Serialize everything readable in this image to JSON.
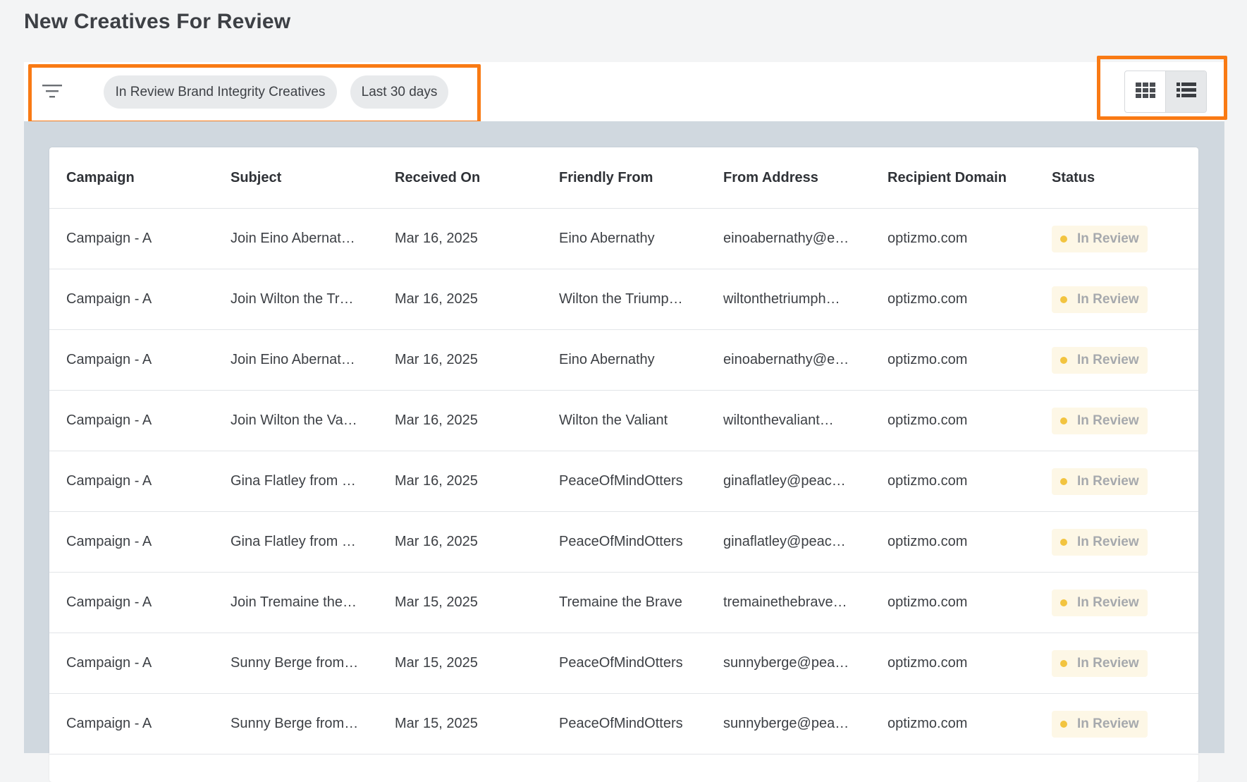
{
  "page": {
    "title": "New Creatives For Review"
  },
  "filters": {
    "chips": [
      "In Review Brand Integrity Creatives",
      "Last 30 days"
    ]
  },
  "view_toggle": {
    "active": "list"
  },
  "colors": {
    "accent_highlight": "#f97a14",
    "status_dot": "#f2c440",
    "status_bg": "#fdf7e6"
  },
  "table": {
    "headers": [
      "Campaign",
      "Subject",
      "Received On",
      "Friendly From",
      "From Address",
      "Recipient Domain",
      "Status"
    ],
    "rows": [
      {
        "campaign": "Campaign - A",
        "subject": "Join Eino Abernat…",
        "received": "Mar 16, 2025",
        "friendly_from": "Eino Abernathy",
        "from_address": "einoabernathy@e…",
        "domain": "optizmo.com",
        "status": "In Review"
      },
      {
        "campaign": "Campaign - A",
        "subject": "Join Wilton the Tr…",
        "received": "Mar 16, 2025",
        "friendly_from": "Wilton the Triump…",
        "from_address": "wiltonthetriumph…",
        "domain": "optizmo.com",
        "status": "In Review"
      },
      {
        "campaign": "Campaign - A",
        "subject": "Join Eino Abernat…",
        "received": "Mar 16, 2025",
        "friendly_from": "Eino Abernathy",
        "from_address": "einoabernathy@e…",
        "domain": "optizmo.com",
        "status": "In Review"
      },
      {
        "campaign": "Campaign - A",
        "subject": "Join Wilton the Va…",
        "received": "Mar 16, 2025",
        "friendly_from": "Wilton the Valiant",
        "from_address": "wiltonthevaliant…",
        "domain": "optizmo.com",
        "status": "In Review"
      },
      {
        "campaign": "Campaign - A",
        "subject": "Gina Flatley from …",
        "received": "Mar 16, 2025",
        "friendly_from": "PeaceOfMindOtters",
        "from_address": "ginaflatley@peac…",
        "domain": "optizmo.com",
        "status": "In Review"
      },
      {
        "campaign": "Campaign - A",
        "subject": "Gina Flatley from …",
        "received": "Mar 16, 2025",
        "friendly_from": "PeaceOfMindOtters",
        "from_address": "ginaflatley@peac…",
        "domain": "optizmo.com",
        "status": "In Review"
      },
      {
        "campaign": "Campaign - A",
        "subject": "Join Tremaine the…",
        "received": "Mar 15, 2025",
        "friendly_from": "Tremaine the Brave",
        "from_address": "tremainethebrave…",
        "domain": "optizmo.com",
        "status": "In Review"
      },
      {
        "campaign": "Campaign - A",
        "subject": "Sunny Berge from…",
        "received": "Mar 15, 2025",
        "friendly_from": "PeaceOfMindOtters",
        "from_address": "sunnyberge@pea…",
        "domain": "optizmo.com",
        "status": "In Review"
      },
      {
        "campaign": "Campaign - A",
        "subject": "Sunny Berge from…",
        "received": "Mar 15, 2025",
        "friendly_from": "PeaceOfMindOtters",
        "from_address": "sunnyberge@pea…",
        "domain": "optizmo.com",
        "status": "In Review"
      }
    ]
  }
}
